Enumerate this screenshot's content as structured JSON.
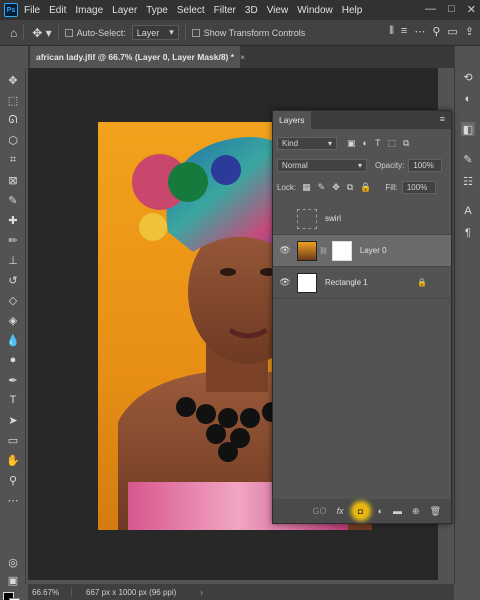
{
  "menu": {
    "logo": "Ps",
    "items": [
      "File",
      "Edit",
      "Image",
      "Layer",
      "Type",
      "Select",
      "Filter",
      "3D",
      "View",
      "Window",
      "Help"
    ],
    "window_controls": [
      "—",
      "□",
      "✕"
    ]
  },
  "options_bar": {
    "auto_select_label": "Auto-Select:",
    "auto_select_value": "Layer",
    "show_transform_label": "Show Transform Controls"
  },
  "document": {
    "tab_title": "african lady.jfif @ 66.7% (Layer 0, Layer Mask/8) *",
    "tab_close": "×"
  },
  "layers_panel": {
    "title": "Layers",
    "filter_kind": "Kind",
    "blend_mode": "Normal",
    "opacity_label": "Opacity:",
    "opacity_value": "100%",
    "lock_label": "Lock:",
    "fill_label": "Fill:",
    "fill_value": "100%",
    "layers": [
      {
        "name": "swirl",
        "type": "group",
        "selected": false,
        "visible": false
      },
      {
        "name": "Layer 0",
        "type": "photo-with-mask",
        "selected": true,
        "visible": true
      },
      {
        "name": "Rectangle 1",
        "type": "shape",
        "selected": false,
        "visible": true,
        "locked": true
      }
    ],
    "footer_link": "GO",
    "footer_fx": "fx"
  },
  "status_bar": {
    "zoom": "66.67%",
    "dimensions": "667 px x 1000 px (96 ppi)",
    "arrow": "›"
  },
  "colors": {
    "accent_highlight": "#f1c40f",
    "background_orange": "#f2a11d",
    "panel_bg": "#535353"
  },
  "icons": {
    "tools": [
      "move-tool-icon",
      "marquee-tool-icon",
      "lasso-tool-icon",
      "crop-tool-icon",
      "frame-tool-icon",
      "eyedropper-tool-icon",
      "healing-brush-icon",
      "brush-tool-icon",
      "clone-stamp-icon",
      "history-brush-icon",
      "eraser-tool-icon",
      "paint-bucket-icon",
      "blur-tool-icon",
      "dodge-tool-icon",
      "pen-tool-icon",
      "type-tool-icon",
      "path-selection-icon",
      "rectangle-tool-icon",
      "hand-tool-icon",
      "zoom-tool-icon",
      "more-tools-icon"
    ]
  }
}
